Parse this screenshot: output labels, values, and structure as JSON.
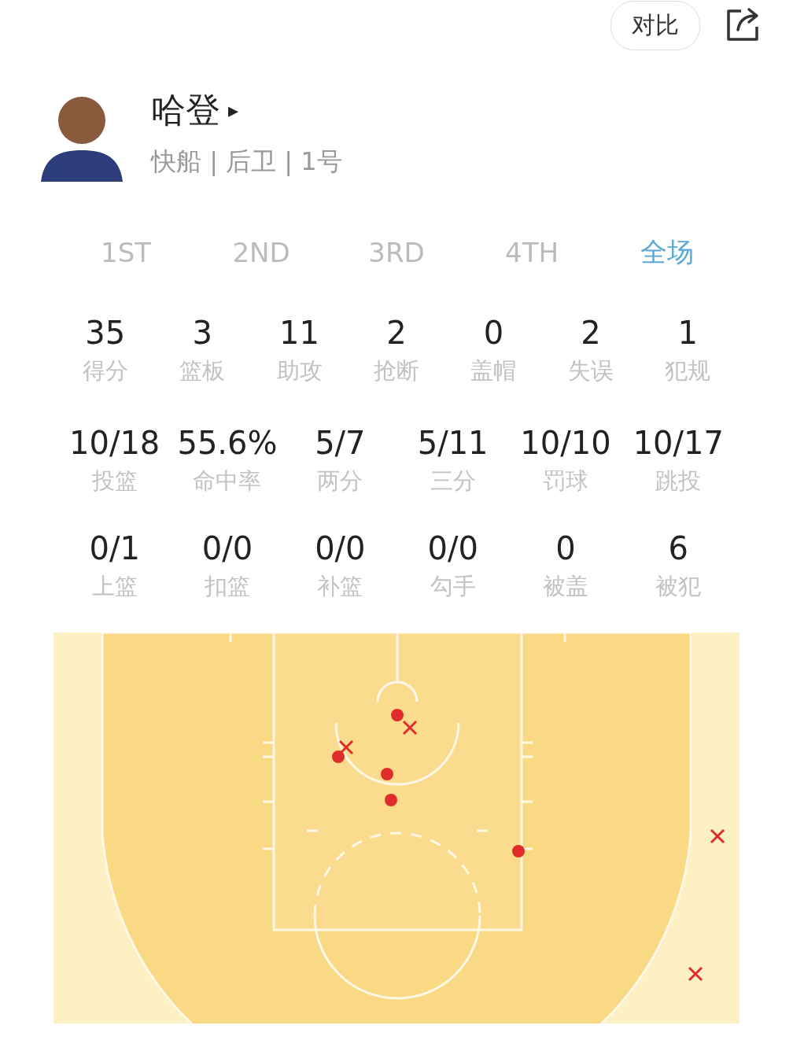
{
  "toolbar": {
    "compare_button": "对比"
  },
  "player": {
    "name": "哈登",
    "caret": "▸",
    "info": "快船 | 后卫 | 1号"
  },
  "tabs": [
    {
      "label": "1ST",
      "selected": false
    },
    {
      "label": "2ND",
      "selected": false
    },
    {
      "label": "3RD",
      "selected": false
    },
    {
      "label": "4TH",
      "selected": false
    },
    {
      "label": "全场",
      "selected": true
    }
  ],
  "stats": [
    {
      "value": "35",
      "label": "得分"
    },
    {
      "value": "3",
      "label": "篮板"
    },
    {
      "value": "11",
      "label": "助攻"
    },
    {
      "value": "2",
      "label": "抢断"
    },
    {
      "value": "0",
      "label": "盖帽"
    },
    {
      "value": "2",
      "label": "失误"
    },
    {
      "value": "1",
      "label": "犯规"
    }
  ],
  "shooting": [
    {
      "value": "10/18",
      "label": "投篮"
    },
    {
      "value": "55.6%",
      "label": "命中率"
    },
    {
      "value": "5/7",
      "label": "两分"
    },
    {
      "value": "5/11",
      "label": "三分"
    },
    {
      "value": "10/10",
      "label": "罚球"
    },
    {
      "value": "10/17",
      "label": "跳投"
    }
  ],
  "shot_types": [
    {
      "value": "0/1",
      "label": "上篮"
    },
    {
      "value": "0/0",
      "label": "扣篮"
    },
    {
      "value": "0/0",
      "label": "补篮"
    },
    {
      "value": "0/0",
      "label": "勾手"
    },
    {
      "value": "0",
      "label": "被盖"
    },
    {
      "value": "6",
      "label": "被犯"
    }
  ],
  "shot_chart": {
    "shots": [
      {
        "kind": "made"
      },
      {
        "kind": "made"
      },
      {
        "kind": "made"
      },
      {
        "kind": "made"
      },
      {
        "kind": "made"
      },
      {
        "kind": "missed"
      },
      {
        "kind": "missed"
      },
      {
        "kind": "missed"
      },
      {
        "kind": "missed"
      }
    ]
  }
}
